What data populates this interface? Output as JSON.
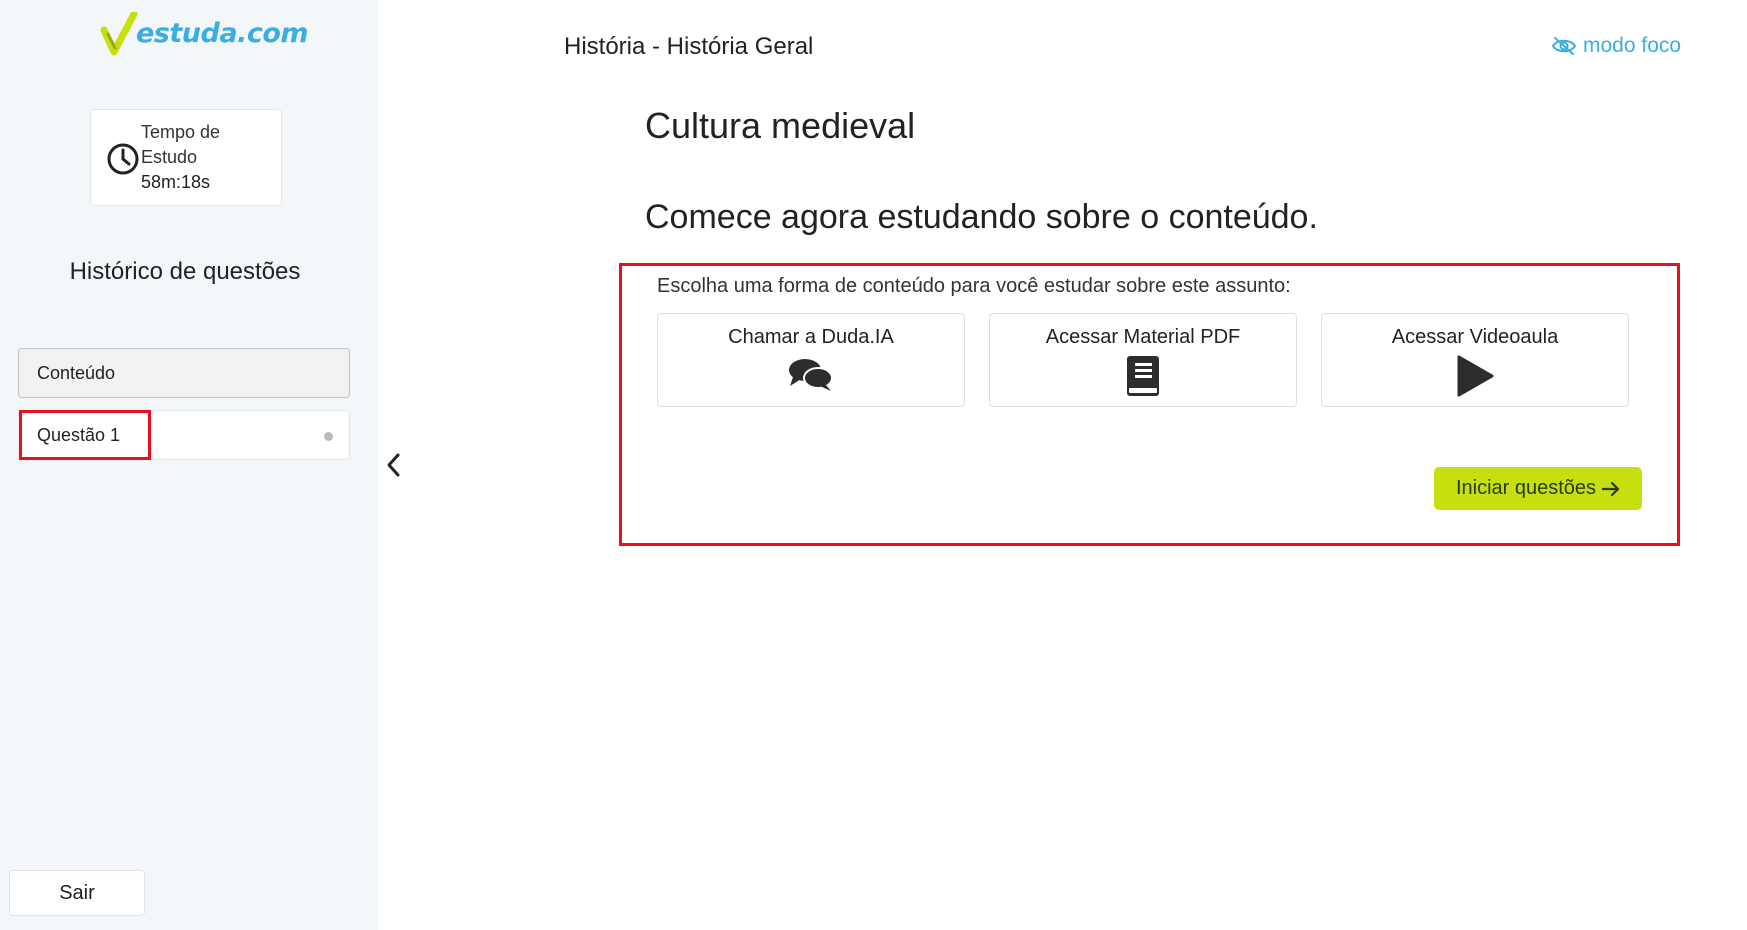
{
  "brand": {
    "logo_text": "estuda.com",
    "accent": "#3aaee0",
    "check_color": "#c7df0e"
  },
  "sidebar": {
    "timer": {
      "label": "Tempo de Estudo",
      "value": "58m:18s"
    },
    "history_title": "Histórico de questões",
    "items": [
      {
        "label": "Conteúdo",
        "active": true
      },
      {
        "label": "Questão 1",
        "active": false
      }
    ],
    "exit_label": "Sair"
  },
  "header": {
    "breadcrumb": "História - História Geral",
    "focus_mode": "modo foco"
  },
  "main": {
    "title": "Cultura medieval",
    "subtitle": "Comece agora estudando sobre o conteúdo.",
    "choose_text": "Escolha uma forma de conteúdo para você estudar sobre este assunto:",
    "options": [
      {
        "label": "Chamar a Duda.IA",
        "icon": "chat-icon"
      },
      {
        "label": "Acessar Material PDF",
        "icon": "book-icon"
      },
      {
        "label": "Acessar Videoaula",
        "icon": "play-icon"
      }
    ],
    "start_button": "Iniciar questões",
    "start_button_color": "#c7df0e"
  },
  "highlight_color": "#e8101f"
}
